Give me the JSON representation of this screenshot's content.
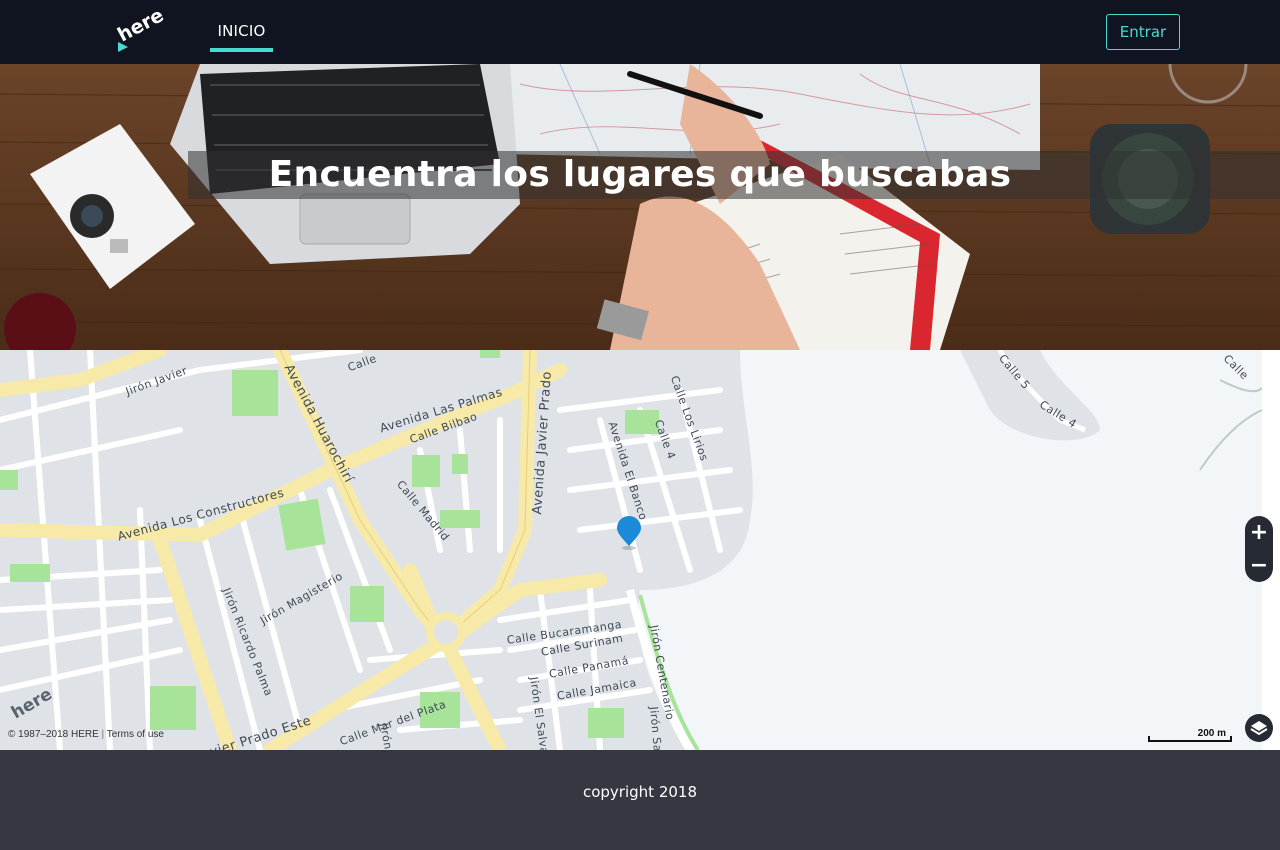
{
  "navbar": {
    "logo_text": "here",
    "links": [
      {
        "label": "INICIO",
        "active": true
      }
    ],
    "login_button": "Entrar",
    "accent_color": "#48dad0",
    "background": "#0f1420"
  },
  "hero": {
    "title": "Encuentra los lugares que buscabas"
  },
  "map": {
    "street_labels": [
      "Jirón Javier",
      "Calle",
      "Avenida Huarochirí",
      "Avenida Las Palmas",
      "Calle Bilbao",
      "Avenida Javier Prado",
      "Calle Los Lirios",
      "Calle 4",
      "Avenida El Banco",
      "Calle 5",
      "Calle 4",
      "Calle",
      "Avenida Los Constructores",
      "Calle Madrid",
      "Jirón Magisterio",
      "Jirón Ricardo Palma",
      "Calle Bucaramanga",
      "Calle Surinam",
      "Calle Panamá",
      "Calle Jamaica",
      "Jirón Centenario",
      "Jirón El Salva",
      "Calle Mar del Plata",
      "Javier Prado Este",
      "Jirón",
      "Jirón Sa"
    ],
    "zoom_in": "+",
    "zoom_out": "−",
    "copyright": "© 1987–2018 HERE",
    "terms": "Terms of use",
    "scale_label": "200 m",
    "watermark": "here",
    "marker_color": "#1a8ad9",
    "icons": [
      "zoom-in-icon",
      "zoom-out-icon",
      "layers-icon",
      "location-pin-icon"
    ]
  },
  "footer": {
    "text": "copyright 2018"
  }
}
